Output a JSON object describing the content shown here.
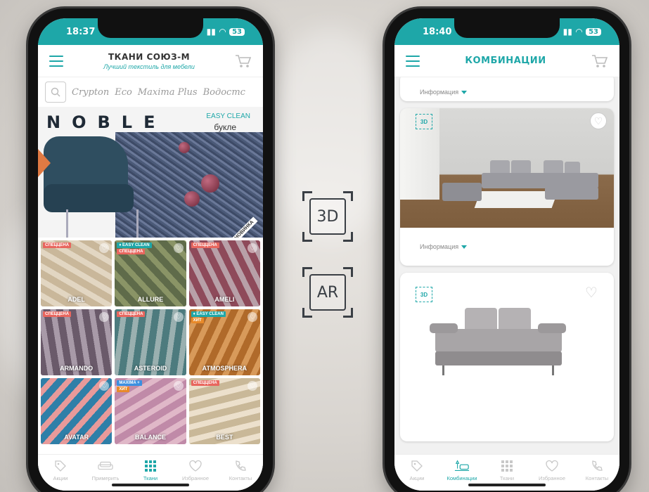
{
  "left_phone": {
    "status_time": "18:37",
    "battery": "53",
    "brand_title": "ТКАНИ СОЮЗ-М",
    "brand_subtitle": "Лучший текстиль для мебели",
    "filters": [
      "Crypton",
      "Eco",
      "Maxima Plus",
      "Водостс"
    ],
    "banner": {
      "title": "NOBLE",
      "badge": "EASY CLEAN",
      "subtitle": "букле",
      "corner_tag": "НОВИНКА"
    },
    "tiles": [
      {
        "name": "ADEL",
        "tags": [
          "СПЕЦЦЕНА"
        ],
        "tag_types": [
          "sale"
        ],
        "colors": [
          "#c9b79a",
          "#e2d6c2"
        ]
      },
      {
        "name": "ALLURE",
        "tags": [
          "♦ EASY CLEAN",
          "СПЕЦЦЕНА"
        ],
        "tag_types": [
          "easy",
          "sale"
        ],
        "colors": [
          "#5f6b4a",
          "#8a9466"
        ]
      },
      {
        "name": "AMELI",
        "tags": [
          "СПЕЦЦЕНА"
        ],
        "tag_types": [
          "sale"
        ],
        "colors": [
          "#8e4a5a",
          "#b8a0a8"
        ]
      },
      {
        "name": "ARMANDO",
        "tags": [
          "СПЕЦЦЕНА"
        ],
        "tag_types": [
          "sale"
        ],
        "colors": [
          "#6a5a6a",
          "#a89aa8"
        ]
      },
      {
        "name": "ASTEROID",
        "tags": [
          "СПЕЦЦЕНА"
        ],
        "tag_types": [
          "sale"
        ],
        "colors": [
          "#4d7b7e",
          "#9ab0b0"
        ]
      },
      {
        "name": "ATMOSPHERA",
        "tags": [
          "♦ EASY CLEAN",
          "ХИТ"
        ],
        "tag_types": [
          "easy",
          "hit"
        ],
        "colors": [
          "#b06a2a",
          "#d89a5a"
        ]
      },
      {
        "name": "AVATAR",
        "tags": [],
        "tag_types": [],
        "colors": [
          "#2f7fa8",
          "#e89a9a"
        ]
      },
      {
        "name": "BALANCE",
        "tags": [
          "MAXIMA +",
          "ХИТ"
        ],
        "tag_types": [
          "maxima",
          "hit"
        ],
        "colors": [
          "#c08aa8",
          "#e0b8c8"
        ]
      },
      {
        "name": "BEST",
        "tags": [
          "СПЕЦЦЕНА"
        ],
        "tag_types": [
          "sale"
        ],
        "colors": [
          "#c9b898",
          "#ece0cc"
        ]
      }
    ],
    "tabs": [
      {
        "label": "Акции",
        "icon": "tag-icon",
        "active": false
      },
      {
        "label": "Примерить",
        "icon": "sofa-icon",
        "active": false
      },
      {
        "label": "Ткани",
        "icon": "grid-icon",
        "active": true
      },
      {
        "label": "Избранное",
        "icon": "heart-icon",
        "active": false
      },
      {
        "label": "Контакты",
        "icon": "phone-icon",
        "active": false
      }
    ]
  },
  "center": {
    "badge_3d": "3D",
    "badge_ar": "AR"
  },
  "right_phone": {
    "status_time": "18:40",
    "battery": "53",
    "title": "КОМБИНАЦИИ",
    "info_label": "Информация",
    "badge_3d": "3D",
    "tabs": [
      {
        "label": "Акции",
        "icon": "tag-icon",
        "active": false
      },
      {
        "label": "Комбинации",
        "icon": "sofa-lamp-icon",
        "active": true
      },
      {
        "label": "Ткани",
        "icon": "grid-icon",
        "active": false
      },
      {
        "label": "Избранное",
        "icon": "heart-icon",
        "active": false
      },
      {
        "label": "Контакты",
        "icon": "phone-icon",
        "active": false
      }
    ]
  },
  "colors": {
    "accent": "#1ea7a8",
    "sale_tag": "#e8665e",
    "hit_tag": "#e88a2a",
    "filter_tab": "#e07a43"
  }
}
